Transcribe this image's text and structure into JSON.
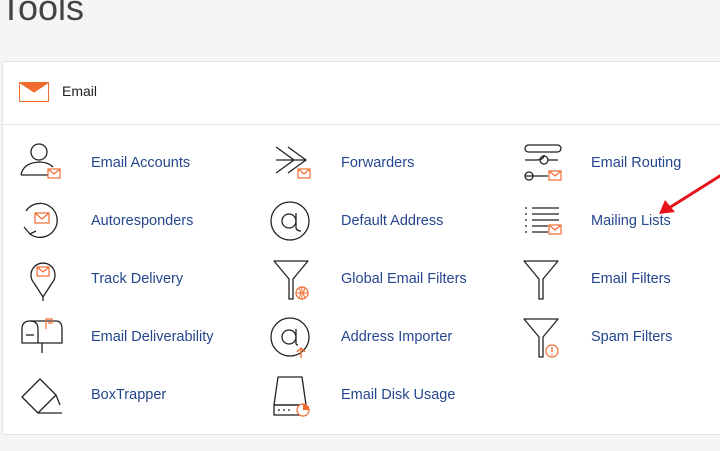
{
  "page": {
    "title": "Tools"
  },
  "section": {
    "label": "Email",
    "icon": "envelope-icon",
    "accent": "#f06b2f"
  },
  "items": [
    {
      "label": "Email Accounts",
      "icon": "user-mail-icon"
    },
    {
      "label": "Forwarders",
      "icon": "forward-arrow-icon"
    },
    {
      "label": "Email Routing",
      "icon": "routing-icon"
    },
    {
      "label": "Autoresponders",
      "icon": "autoresponder-icon"
    },
    {
      "label": "Default Address",
      "icon": "at-sign-icon"
    },
    {
      "label": "Mailing Lists",
      "icon": "list-mail-icon"
    },
    {
      "label": "Track Delivery",
      "icon": "location-pin-icon"
    },
    {
      "label": "Global Email Filters",
      "icon": "globe-filter-icon"
    },
    {
      "label": "Email Filters",
      "icon": "filter-icon"
    },
    {
      "label": "Email Deliverability",
      "icon": "mailbox-icon"
    },
    {
      "label": "Address Importer",
      "icon": "at-upload-icon"
    },
    {
      "label": "Spam Filters",
      "icon": "spam-filter-icon"
    },
    {
      "label": "BoxTrapper",
      "icon": "boxtrapper-icon"
    },
    {
      "label": "Email Disk Usage",
      "icon": "disk-usage-icon"
    }
  ],
  "colors": {
    "link": "#24468e",
    "icon_stroke": "#222222",
    "accent": "#f06b2f",
    "annotation_arrow": "#e8131a"
  }
}
